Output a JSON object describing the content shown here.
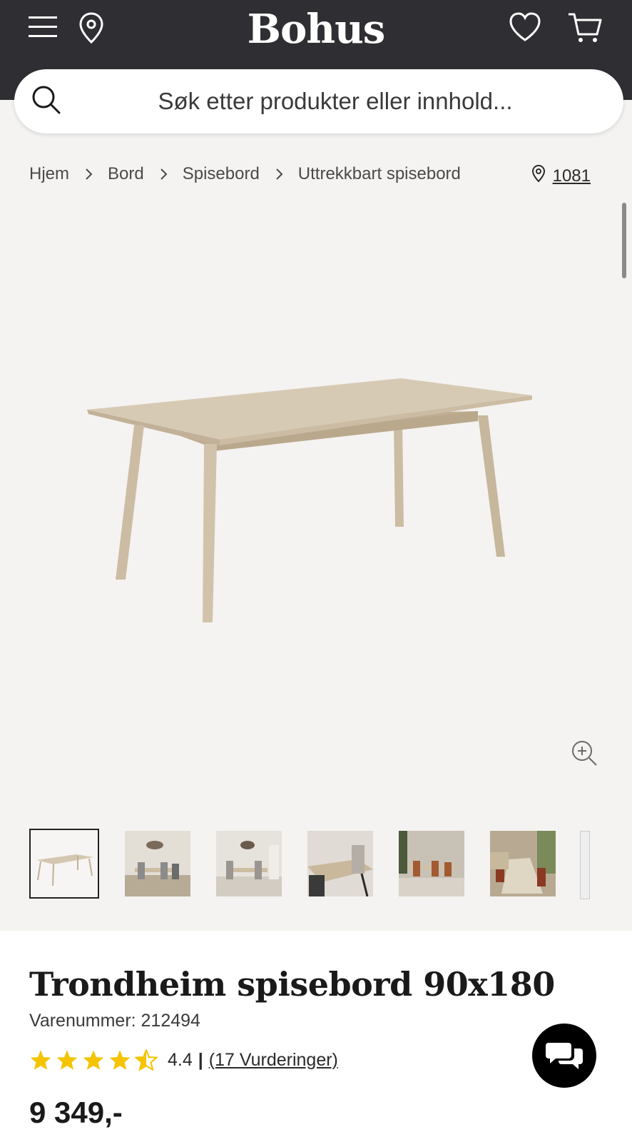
{
  "header": {
    "logo": "Bohus",
    "menu_icon": "hamburger-menu-icon",
    "location_icon": "location-pin-icon",
    "wishlist_icon": "heart-icon",
    "cart_icon": "shopping-cart-icon",
    "background_color": "#2f2f33"
  },
  "search": {
    "placeholder": "Søk etter produkter eller innhold..."
  },
  "breadcrumb": {
    "items": [
      "Hjem",
      "Bord",
      "Spisebord",
      "Uttrekkbart spisebord"
    ],
    "store_number": "1081"
  },
  "gallery": {
    "thumbnail_count": 7,
    "active_index": 0
  },
  "product": {
    "title": "Trondheim spisebord 90x180",
    "sku_label": "Varenummer: 212494",
    "rating": "4.4",
    "rating_value": 4.4,
    "rating_max": 5,
    "rating_separator": "|",
    "reviews_label": "(17 Vurderinger)",
    "price": "9 349,-"
  },
  "colors": {
    "star": "#f5c400",
    "wood": "#cdbfa8"
  }
}
